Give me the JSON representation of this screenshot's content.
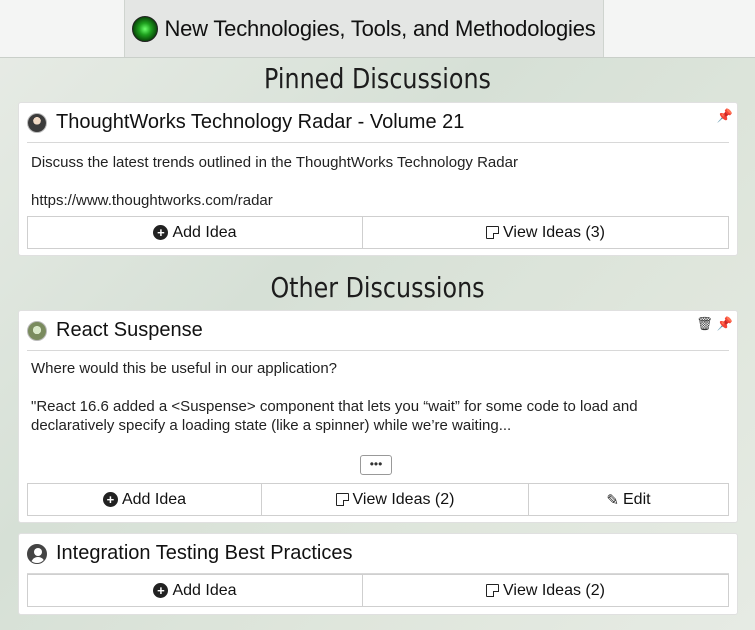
{
  "header": {
    "title": "New Technologies, Tools, and Methodologies",
    "logo_icon": "radar-icon"
  },
  "sections": {
    "pinned": "Pinned Discussions",
    "other": "Other Discussions"
  },
  "colors": {
    "pin_active": "#e02020",
    "icon_dark": "#333333"
  },
  "discussions": [
    {
      "title": "ThoughtWorks Technology Radar - Volume 21",
      "avatar_icon": "user-photo-icon",
      "pinned": true,
      "body": "Discuss the latest trends outlined in the ThoughtWorks Technology Radar\n\nhttps://www.thoughtworks.com/radar",
      "actions": {
        "add": "Add Idea",
        "view": "View Ideas (3)"
      }
    },
    {
      "title": "React Suspense",
      "avatar_icon": "user-photo-icon",
      "pinned": false,
      "body": "Where would this be useful in our application?\n\n\"React 16.6 added a <Suspense> component that lets you “wait” for some code to load and declaratively specify a loading state (like a spinner) while we’re waiting...",
      "more_label": "•••",
      "actions": {
        "add": "Add Idea",
        "view": "View Ideas (2)",
        "edit": "Edit"
      }
    },
    {
      "title": "Integration Testing Best Practices",
      "avatar_icon": "user-circle-icon",
      "pinned": false,
      "actions": {
        "add": "Add Idea",
        "view": "View Ideas (2)"
      }
    }
  ]
}
